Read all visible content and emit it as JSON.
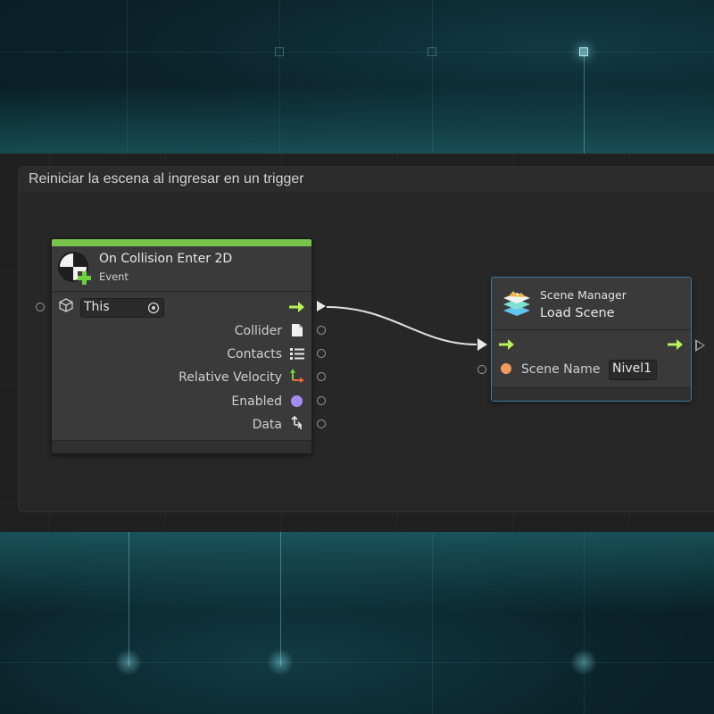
{
  "group": {
    "title": "Reiniciar la escena al ingresar en un trigger"
  },
  "event_node": {
    "title": "On Collision Enter 2D",
    "subtitle": "Event",
    "header_color": "#79c44a",
    "target_field": {
      "value": "This"
    },
    "outputs": [
      {
        "label": "Collider",
        "icon": "document-icon"
      },
      {
        "label": "Contacts",
        "icon": "list-icon"
      },
      {
        "label": "Relative Velocity",
        "icon": "vector-icon"
      },
      {
        "label": "Enabled",
        "icon": "bool-dot-icon"
      },
      {
        "label": "Data",
        "icon": "data-icon"
      }
    ]
  },
  "scene_node": {
    "category": "Scene Manager",
    "title": "Load Scene",
    "input_label": "Scene Name",
    "input_value": "Nivel1",
    "icon": "scene-layers-icon"
  },
  "colors": {
    "flow_arrow": "#b6f25a",
    "string_port": "#f29a5c",
    "bool_port": "#a58cf0",
    "selection_outline": "#3b7fa8"
  }
}
